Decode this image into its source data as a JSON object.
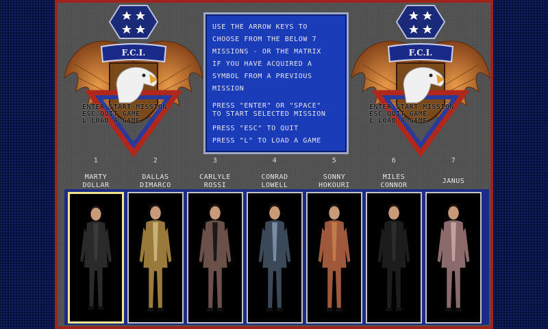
{
  "instructions": {
    "lines": [
      "USE THE ARROW KEYS TO",
      "CHOOSE FROM THE BELOW 7",
      "MISSIONS - OR THE MATRIX",
      "IF YOU HAVE ACQUIRED A",
      "SYMBOL FROM A PREVIOUS",
      "MISSION"
    ],
    "enter_line_1": "PRESS \"ENTER\" OR \"SPACE\"",
    "enter_line_2": "TO START SELECTED MISSION",
    "esc_line": "PRESS \"ESC\" TO QUIT",
    "load_line": "PRESS \"L\" TO LOAD A GAME"
  },
  "emblem": {
    "org": "F.C.I.",
    "menu_row_1": "ENTER START MISSION",
    "menu_row_2": "ESC   QUIT GAME",
    "menu_row_3": "L     LOAD A GAME"
  },
  "agents": [
    {
      "num": "1",
      "line1": "MARTY",
      "line2": "DOLLAR",
      "coat": "#2a2a2a",
      "shirt": "#3a3a3a",
      "selected": true
    },
    {
      "num": "2",
      "line1": "DALLAS",
      "line2": "DIMARCO",
      "coat": "#9a7a3a",
      "shirt": "#c9b27a",
      "selected": false
    },
    {
      "num": "3",
      "line1": "CARLYLE",
      "line2": "ROSSI",
      "coat": "#6a5048",
      "shirt": "#1a1a1a",
      "selected": false
    },
    {
      "num": "4",
      "line1": "CONRAD",
      "line2": "LOWELL",
      "coat": "#3a4858",
      "shirt": "#7a8aa0",
      "selected": false
    },
    {
      "num": "5",
      "line1": "SONNY",
      "line2": "HOKOURI",
      "coat": "#a0583a",
      "shirt": "#c27a4a",
      "selected": false
    },
    {
      "num": "6",
      "line1": "MILES",
      "line2": "CONNOR",
      "coat": "#1c1c1c",
      "shirt": "#2c2c2c",
      "selected": false
    },
    {
      "num": "7",
      "line1": "",
      "line2": "JANUS",
      "coat": "#8a6a6a",
      "shirt": "#c2a0a0",
      "selected": false
    }
  ],
  "colors": {
    "frame": "#a0231a",
    "panel_blue": "#1a3cb8",
    "selected_border": "#f2e488",
    "wing_gold": "#c8742a",
    "badge_red": "#b0281c"
  }
}
